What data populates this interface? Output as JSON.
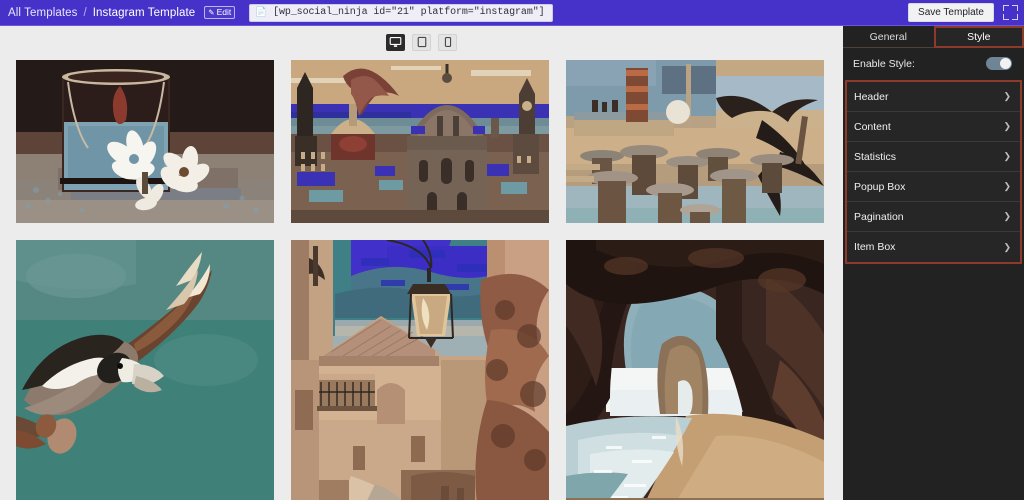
{
  "topbar": {
    "breadcrumb_root": "All Templates",
    "breadcrumb_sep": "/",
    "breadcrumb_current": "Instagram Template",
    "edit_badge": "Edit",
    "edit_icon": "pencil-icon",
    "shortcode_icon": "document-icon",
    "shortcode": "[wp_social_ninja id=\"21\" platform=\"instagram\"]",
    "save_label": "Save Template",
    "fullscreen_icon": "fullscreen-icon",
    "bar_color": "#4632c8"
  },
  "canvas": {
    "devices": [
      {
        "name": "desktop",
        "label": "Desktop",
        "active": true
      },
      {
        "name": "tablet",
        "label": "Tablet",
        "active": false
      },
      {
        "name": "mobile",
        "label": "Mobile",
        "active": false
      }
    ],
    "background": "#ececec",
    "items": [
      {
        "alt": "Posterized photo of a drinking glass with white flowers on a table",
        "row": 1
      },
      {
        "alt": "Posterized cityscape with large baroque dome and church towers",
        "row": 1
      },
      {
        "alt": "Posterized beach bar with wooden stools and tables overlooking the sea",
        "row": 1
      },
      {
        "alt": "Posterized puffin bird in flight against teal sky",
        "row": 2
      },
      {
        "alt": "Posterized narrow Italian alley with hanging street lantern and lake view",
        "row": 2
      },
      {
        "alt": "Posterized sea cave rock arch on a sandy beach",
        "row": 2
      }
    ]
  },
  "panel": {
    "tabs": [
      {
        "label": "General",
        "active": false
      },
      {
        "label": "Style",
        "active": true
      }
    ],
    "enable_style_label": "Enable Style:",
    "enable_style_on": true,
    "accent_color": "#8e3a2a",
    "sections": [
      {
        "label": "Header"
      },
      {
        "label": "Content"
      },
      {
        "label": "Statistics"
      },
      {
        "label": "Popup Box"
      },
      {
        "label": "Pagination"
      },
      {
        "label": "Item Box"
      }
    ]
  }
}
